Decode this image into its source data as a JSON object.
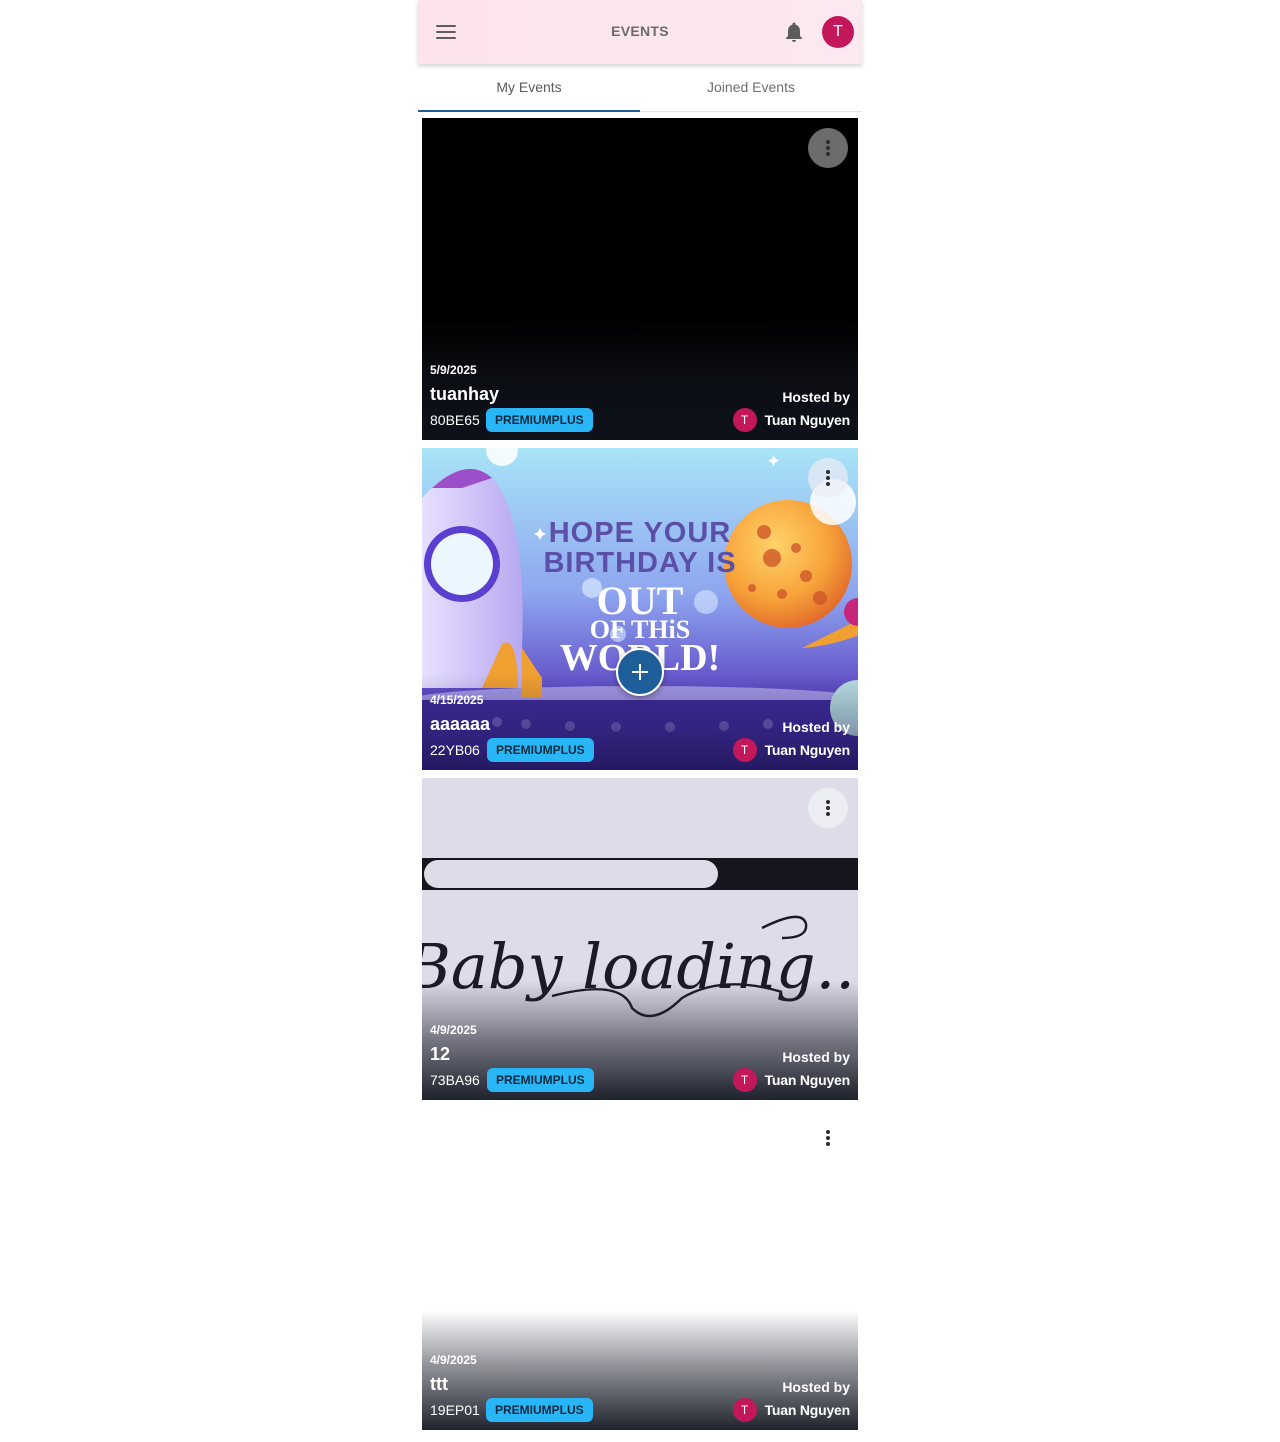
{
  "header": {
    "title": "EVENTS",
    "avatar_initial": "T"
  },
  "tabs": [
    {
      "label": "My Events",
      "active": true
    },
    {
      "label": "Joined Events",
      "active": false
    }
  ],
  "events": [
    {
      "date": "5/9/2025",
      "title": "tuanhay",
      "code": "80BE65",
      "badge": "PREMIUMPLUS",
      "hosted_label": "Hosted by",
      "host_initial": "T",
      "host_name": "Tuan Nguyen"
    },
    {
      "date": "4/15/2025",
      "title": "aaaaaa",
      "code": "22YB06",
      "badge": "PREMIUMPLUS",
      "hosted_label": "Hosted by",
      "host_initial": "T",
      "host_name": "Tuan Nguyen",
      "image_text": [
        "HOPE YOUR",
        "BIRTHDAY IS",
        "OUT",
        "OF THiS",
        "WORLD!"
      ]
    },
    {
      "date": "4/9/2025",
      "title": "12",
      "code": "73BA96",
      "badge": "PREMIUMPLUS",
      "hosted_label": "Hosted by",
      "host_initial": "T",
      "host_name": "Tuan Nguyen",
      "image_text": "Baby loading..."
    },
    {
      "date": "4/9/2025",
      "title": "ttt",
      "code": "19EP01",
      "badge": "PREMIUMPLUS",
      "hosted_label": "Hosted by",
      "host_initial": "T",
      "host_name": "Tuan Nguyen"
    }
  ],
  "colors": {
    "accent": "#1f5f99",
    "badge": "#29b6f6",
    "avatar": "#c2185b"
  }
}
